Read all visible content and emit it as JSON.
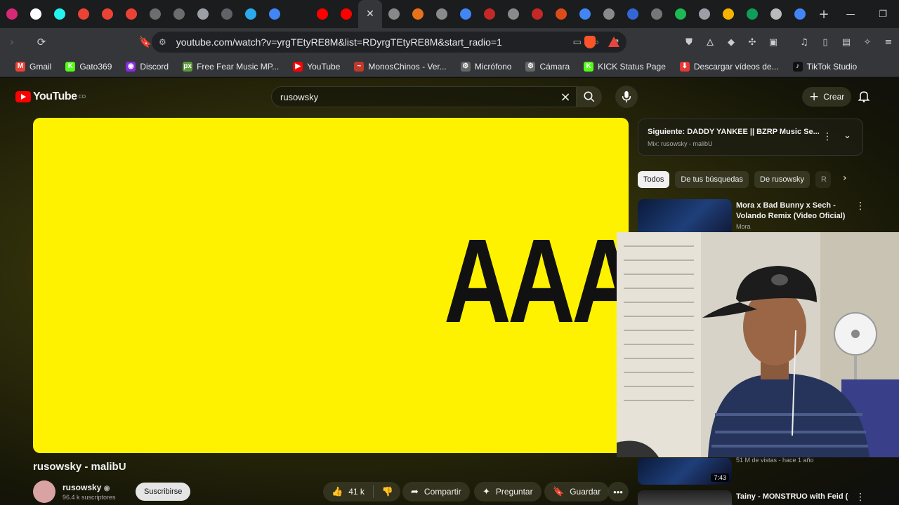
{
  "browser": {
    "tab_icons": [
      "instagram-icon",
      "x-icon",
      "tiktok-icon",
      "gmail-icon",
      "gmail-icon",
      "gmail-icon",
      "ae-icon",
      "ae-icon",
      "circle-icon",
      "mw-icon",
      "telegram-icon",
      "google-icon",
      "blank-icon",
      "youtube-icon",
      "youtube-icon",
      "close-icon",
      "ui-icon",
      "settings-icon",
      "google-icon",
      "face-icon",
      "settings-icon",
      "face-icon",
      "ring-icon",
      "google-icon",
      "settings-icon",
      "photos-icon",
      "af-icon",
      "spotify-icon",
      "circle-icon",
      "apps-icon",
      "drive-icon",
      "mute-icon",
      "google-icon"
    ],
    "active_tab_glyph": "✕",
    "new_tab": "+",
    "url": "youtube.com/watch?v=yrgTEtyRE8M&list=RDyrgTEtyRE8M&start_radio=1",
    "bookmarks": [
      {
        "label": "Gmail",
        "icon": "M",
        "color": "#ea4335"
      },
      {
        "label": "Gato369",
        "icon": "K",
        "color": "#53fc18"
      },
      {
        "label": "Discord",
        "icon": "◉",
        "color": "#8a2be2"
      },
      {
        "label": "Free Fear Music MP...",
        "icon": "px",
        "color": "#5a9a3a"
      },
      {
        "label": "YouTube",
        "icon": "▶",
        "color": "#ff0000"
      },
      {
        "label": "MonosChinos - Ver...",
        "icon": "~",
        "color": "#c0392b"
      },
      {
        "label": "Micrófono",
        "icon": "⚙",
        "color": "#666"
      },
      {
        "label": "Cámara",
        "icon": "⚙",
        "color": "#666"
      },
      {
        "label": "KICK Status Page",
        "icon": "K",
        "color": "#53fc18"
      },
      {
        "label": "Descargar vídeos de...",
        "icon": "⬇",
        "color": "#e53935"
      },
      {
        "label": "TikTok Studio",
        "icon": "♪",
        "color": "#111"
      }
    ]
  },
  "youtube": {
    "logo": "YouTube",
    "country": "CO",
    "search_query": "rusowsky",
    "create_label": "Crear",
    "video_text": "AAA",
    "video_title": "rusowsky - malibU",
    "channel_name": "rusowsky",
    "channel_subs": "96.4 k suscriptores",
    "subscribe_label": "Suscribirse",
    "likes": "41 k",
    "share_label": "Compartir",
    "ask_label": "Preguntar",
    "save_label": "Guardar",
    "next_up": "Siguiente: DADDY YANKEE || BZRP Music Se...",
    "mix_label": "Mix: rusowsky - malibU",
    "chips": [
      "Todos",
      "De tus búsquedas",
      "De rusowsky",
      "R"
    ],
    "recommendations": [
      {
        "title": "Mora x Bad Bunny x Sech - Volando Remix (Video Oficial)",
        "channel": "Mora",
        "views": ""
      },
      {
        "title": "",
        "channel": "",
        "views": "51 M de vistas - hace 1 año",
        "duration": "7:43"
      },
      {
        "title": "Tainy - MONSTRUO with Feid (Official Music Video)",
        "channel": "",
        "views": ""
      }
    ]
  }
}
